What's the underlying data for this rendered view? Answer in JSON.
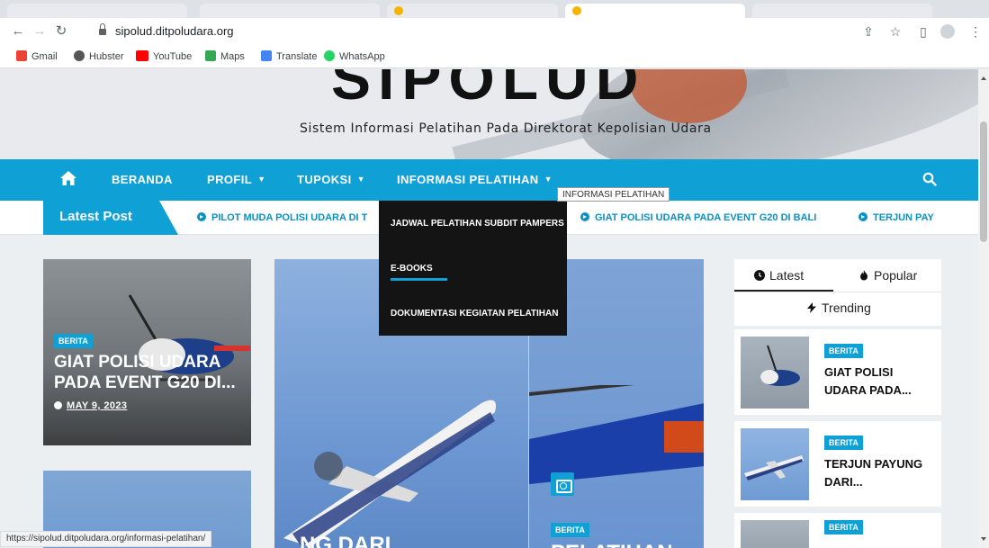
{
  "browser": {
    "url": "sipolud.ditpoludara.org",
    "bookmarks": [
      {
        "label": "Gmail",
        "icon": "gmail-icon"
      },
      {
        "label": "Hubster",
        "icon": "hubster-icon"
      },
      {
        "label": "YouTube",
        "icon": "youtube-icon"
      },
      {
        "label": "Maps",
        "icon": "maps-icon"
      },
      {
        "label": "Translate",
        "icon": "translate-icon"
      },
      {
        "label": "WhatsApp",
        "icon": "whatsapp-icon"
      }
    ],
    "status_url": "https://sipolud.ditpoludara.org/informasi-pelatihan/"
  },
  "site": {
    "logo": "SIPOLUD",
    "tagline": "Sistem Informasi Pelatihan Pada Direktorat Kepolisian Udara",
    "accent": "#0fa0d6"
  },
  "nav": {
    "items": [
      {
        "label": "BERANDA",
        "has_caret": false
      },
      {
        "label": "PROFIL",
        "has_caret": true
      },
      {
        "label": "TUPOKSI",
        "has_caret": true
      },
      {
        "label": "INFORMASI PELATIHAN",
        "has_caret": true
      }
    ],
    "caret": "▼",
    "tooltip": "INFORMASI PELATIHAN"
  },
  "dropdown": {
    "items": [
      "JADWAL PELATIHAN SUBDIT PAMPERS",
      "E-BOOKS",
      "DOKUMENTASI KEGIATAN PELATIHAN"
    ],
    "highlighted": "E-BOOKS"
  },
  "ticker": {
    "label": "Latest Post",
    "items": [
      "PILOT MUDA POLISI UDARA DI T",
      "GIAT POLISI UDARA PADA EVENT G20 DI BALI",
      "TERJUN PAY"
    ]
  },
  "posts": {
    "featured_left": {
      "badge": "BERITA",
      "title": "GIAT POLISI UDARA PADA EVENT G20 DI...",
      "date": "MAY 9, 2023"
    },
    "mid_title_partial": "...NG DARI",
    "right": {
      "badge": "BERITA",
      "title_partial": "PELATIHAN"
    }
  },
  "sidebar": {
    "tabs": [
      {
        "label": "Latest",
        "icon": "clock-icon"
      },
      {
        "label": "Popular",
        "icon": "fire-icon"
      },
      {
        "label": "Trending",
        "icon": "bolt-icon"
      }
    ],
    "items": [
      {
        "badge": "BERITA",
        "title": "GIAT POLISI UDARA PADA..."
      },
      {
        "badge": "BERITA",
        "title": "TERJUN PAYUNG DARI..."
      },
      {
        "badge": "BERITA",
        "title": ""
      }
    ]
  }
}
